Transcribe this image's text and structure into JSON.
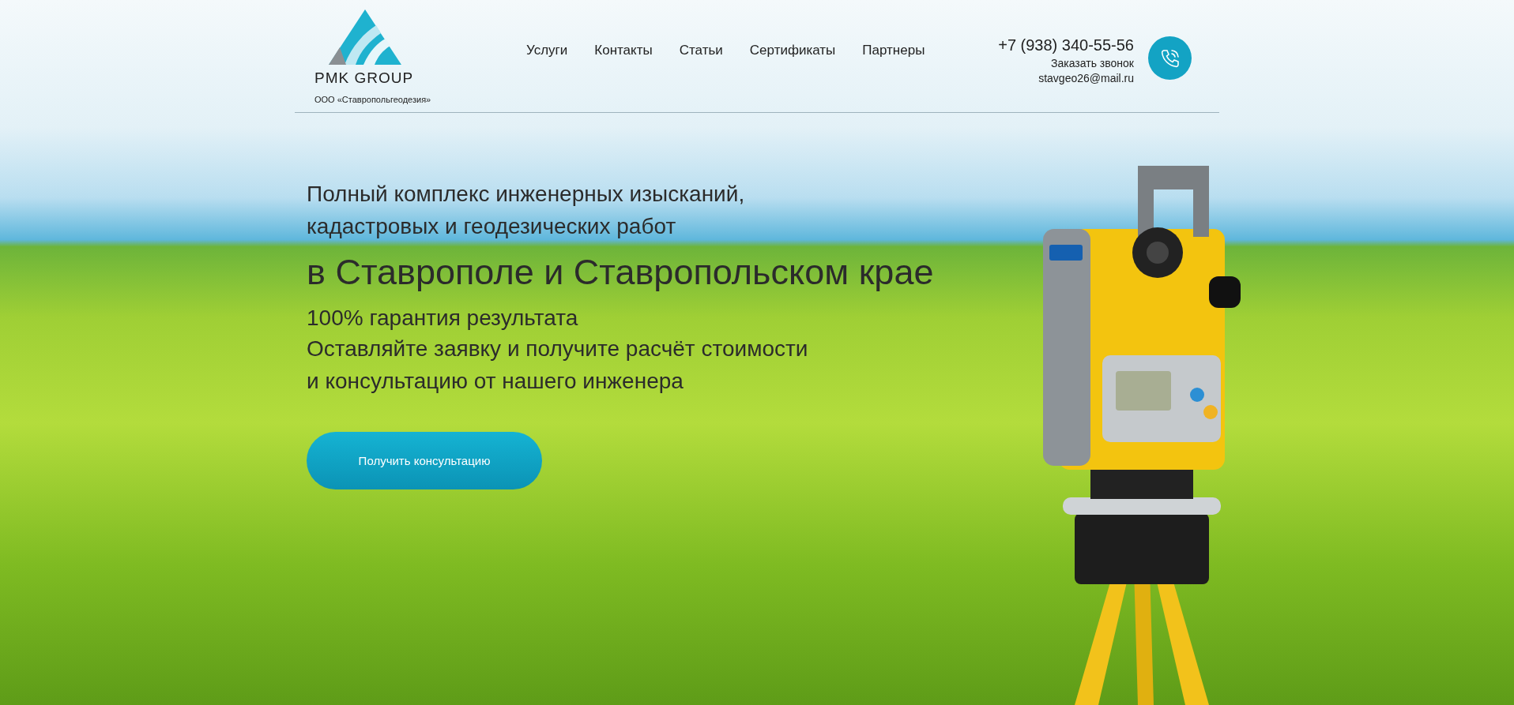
{
  "logo": {
    "name": "PMK GROUP",
    "subtitle": "ООО «Ставропольгеодезия»"
  },
  "nav": [
    {
      "label": "Услуги"
    },
    {
      "label": "Контакты"
    },
    {
      "label": "Статьи"
    },
    {
      "label": "Сертификаты"
    },
    {
      "label": "Партнеры"
    }
  ],
  "contact": {
    "phone": "+7 (938) 340-55-56",
    "callback": "Заказать звонок",
    "email": "stavgeo26@mail.ru"
  },
  "hero": {
    "lead": [
      "Полный комплекс инженерных изысканий,",
      "кадастровых и геодезических работ"
    ],
    "headline": "в Ставрополе и Ставропольском крае",
    "guarantee": "100% гарантия результата",
    "offer": [
      "Оставляйте заявку и получите расчёт стоимости",
      "и консультацию от нашего инженера"
    ],
    "button": "Получить консультацию"
  }
}
